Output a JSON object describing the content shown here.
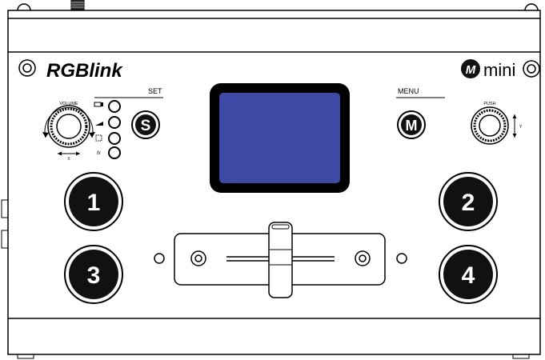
{
  "brand": {
    "logo": "RGBlink",
    "model": "mini",
    "model_badge": "M"
  },
  "labels": {
    "set": "SET",
    "menu": "MENU",
    "volume": "VOLUME",
    "push": "PUSH",
    "volume_axis": "X",
    "push_axis": "Y"
  },
  "buttons": {
    "s_label": "S",
    "m_label": "M",
    "input_1": "1",
    "input_2": "2",
    "input_3": "3",
    "input_4": "4"
  },
  "set_icons": [
    "monitor-icon",
    "volume-wedge-icon",
    "crop-icon",
    "fx-icon"
  ],
  "set_icon_text": {
    "fx": "fx"
  },
  "colors": {
    "screen": "#3c4aa6",
    "button_fill": "#111111",
    "outline": "#000000"
  }
}
